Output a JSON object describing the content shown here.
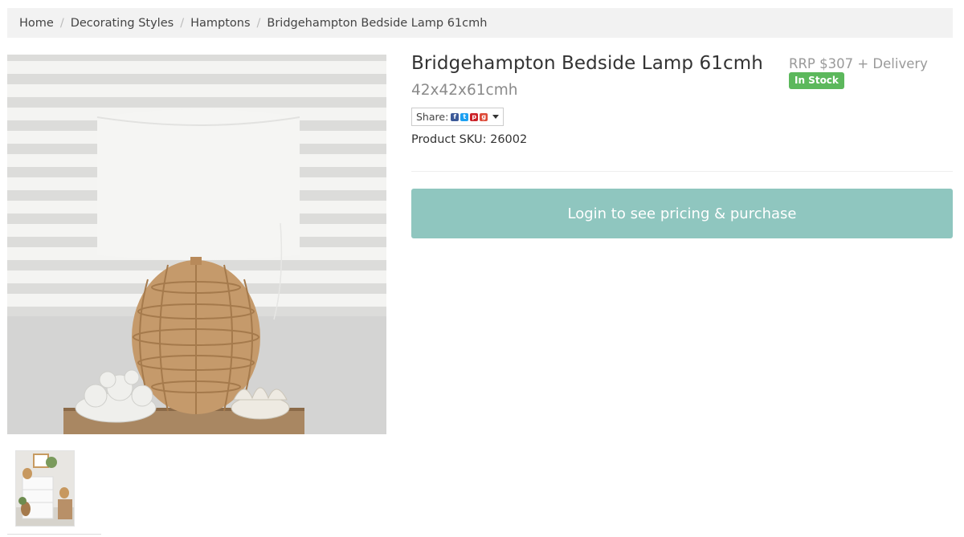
{
  "breadcrumb": {
    "items": [
      "Home",
      "Decorating Styles",
      "Hamptons"
    ],
    "current": "Bridgehampton Bedside Lamp 61cmh",
    "separator": "/"
  },
  "product": {
    "title": "Bridgehampton Bedside Lamp 61cmh",
    "dimensions": "42x42x61cmh",
    "price": "RRP $307 + Delivery",
    "stock_status": "In Stock",
    "sku": "Product SKU: 26002",
    "main_image_alt": "Bridgehampton Bedside Lamp",
    "thumbnail_alt": "Bridgehampton Bedside Lamp styled"
  },
  "share": {
    "label": "Share:",
    "icons": [
      "facebook-icon",
      "twitter-icon",
      "pinterest-icon",
      "google-plus-icon"
    ]
  },
  "actions": {
    "login_label": "Login to see pricing & purchase"
  },
  "colors": {
    "accent_button": "#8fc6bf",
    "stock_badge": "#5cb85c",
    "breadcrumb_bg": "#f2f2f2"
  }
}
